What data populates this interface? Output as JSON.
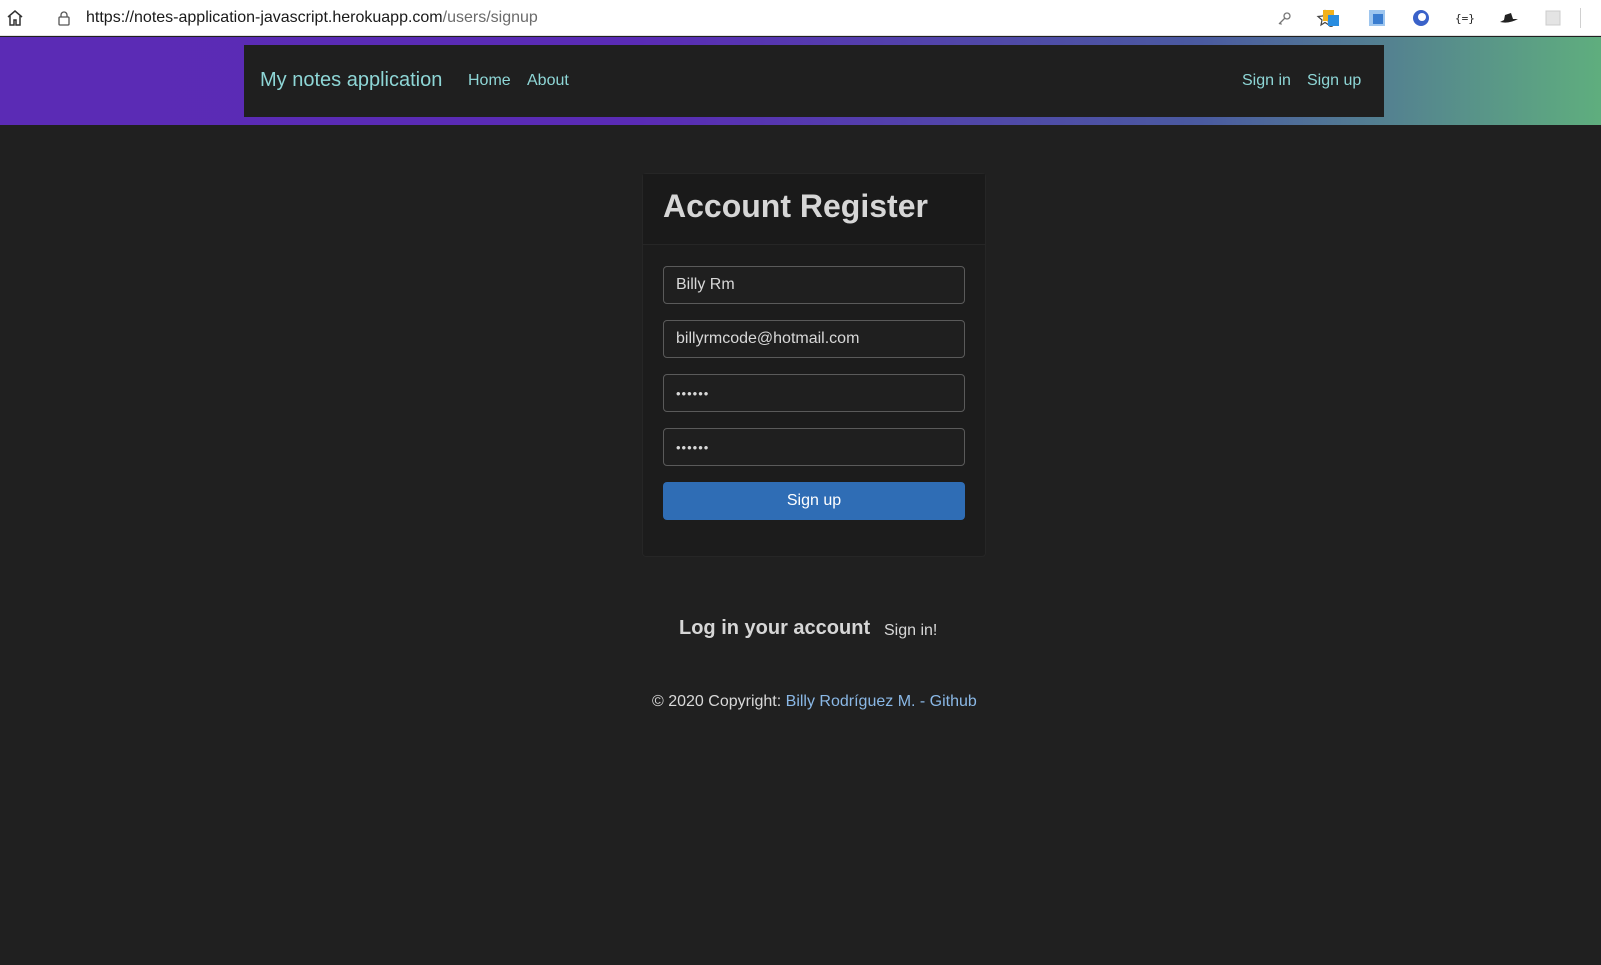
{
  "browser": {
    "url_host": "https://notes-application-javascript.herokuapp.com",
    "url_path": "/users/signup"
  },
  "navbar": {
    "brand": "My notes application",
    "links": [
      "Home",
      "About"
    ],
    "auth_links": [
      "Sign in",
      "Sign up"
    ]
  },
  "register": {
    "title": "Account Register",
    "fields": {
      "name": "Billy Rm",
      "email": "billyrmcode@hotmail.com",
      "password": "••••••",
      "confirm_password": "••••••"
    },
    "submit_label": "Sign up"
  },
  "login_prompt": {
    "heading": "Log in your account",
    "link": "Sign in!"
  },
  "footer": {
    "prefix": "© 2020 Copyright: ",
    "author_link": "Billy Rodríguez M. - Github"
  },
  "colors": {
    "accent_link": "#8ed6d6",
    "button": "#2f6db5",
    "background": "#202020"
  }
}
